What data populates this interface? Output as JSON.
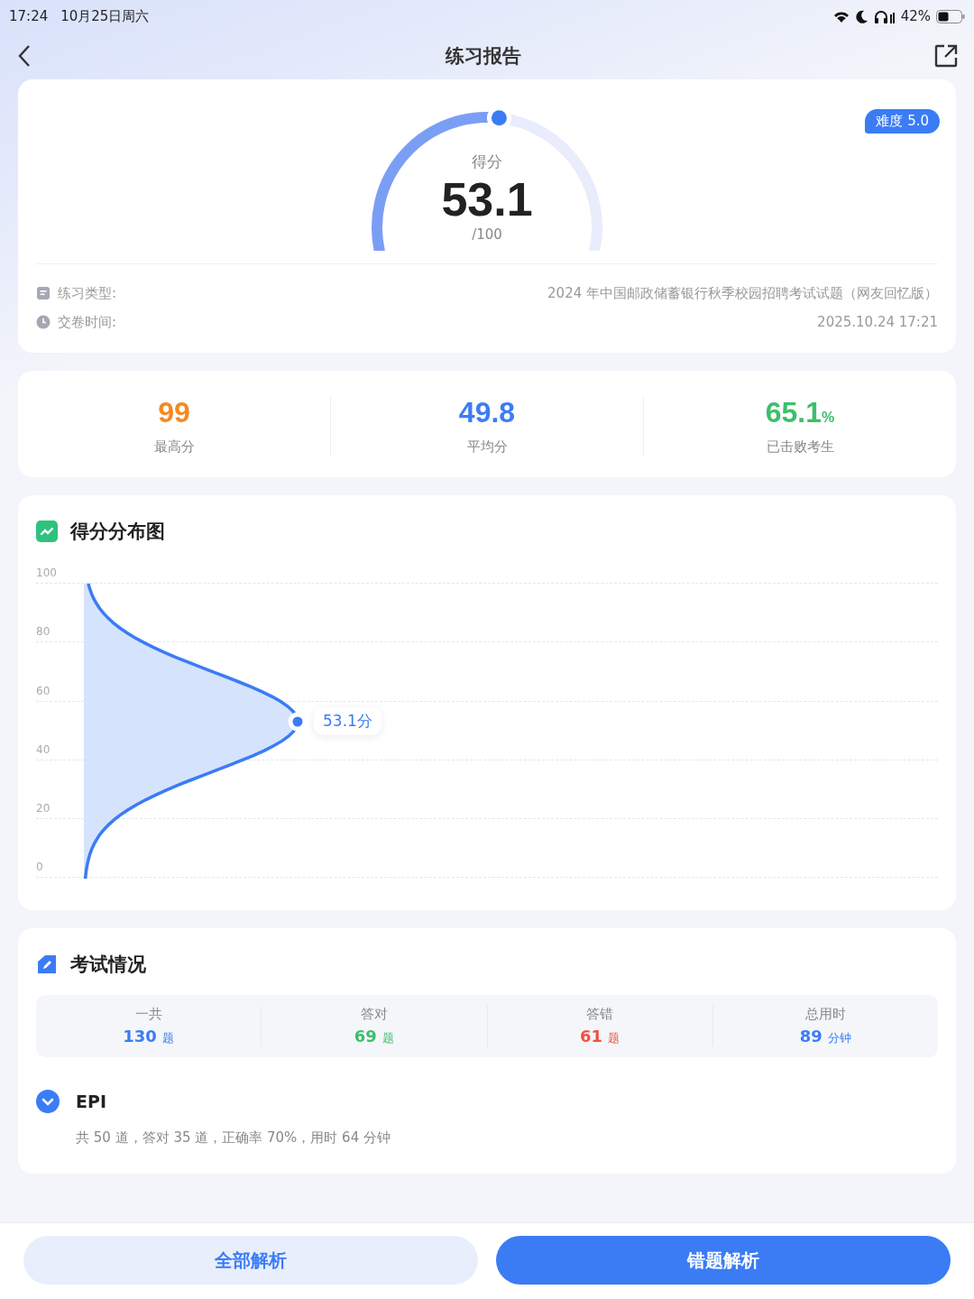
{
  "status_bar": {
    "time": "17:24",
    "date": "10月25日周六",
    "battery": "42%"
  },
  "nav": {
    "title": "练习报告"
  },
  "score_card": {
    "badge": "难度 5.0",
    "label": "得分",
    "score": "53.1",
    "total": "/100",
    "level": 0.531,
    "info": [
      {
        "kind": "doc",
        "label": "练习类型:",
        "value": "2024 年中国邮政储蓄银行秋季校园招聘考试试题（网友回忆版）"
      },
      {
        "kind": "clock",
        "label": "交卷时间:",
        "value": "2025.10.24 17:21"
      }
    ]
  },
  "summary": [
    {
      "value": "99",
      "label": "最高分",
      "color": "#f5891f"
    },
    {
      "value": "49.8",
      "label": "平均分",
      "color": "#3b7cf5"
    },
    {
      "value": "65.1",
      "unit": "%",
      "label": "已击败考生",
      "color": "#3cbf6b"
    }
  ],
  "distribution": {
    "title": "得分分布图",
    "yticks": [
      "100",
      "80",
      "60",
      "40",
      "20",
      "0"
    ],
    "marker_label": "53.1分"
  },
  "exam": {
    "title": "考试情况",
    "stats": [
      {
        "label": "一共",
        "value": "130",
        "unit": "题",
        "color": "#3b7cf5"
      },
      {
        "label": "答对",
        "value": "69",
        "unit": "题",
        "color": "#3cbf6b"
      },
      {
        "label": "答错",
        "value": "61",
        "unit": "题",
        "color": "#f0533f"
      },
      {
        "label": "总用时",
        "value": "89",
        "unit": "分钟",
        "color": "#3b7cf5"
      }
    ],
    "sections": [
      {
        "name": "EPI",
        "expanded": true,
        "detail": "共 50 道，答对 35 道，正确率 70%，用时 64 分钟"
      }
    ]
  },
  "footer": {
    "buttons": [
      {
        "label": "全部解析",
        "kind": "secondary"
      },
      {
        "label": "错题解析",
        "kind": "primary"
      }
    ]
  }
}
